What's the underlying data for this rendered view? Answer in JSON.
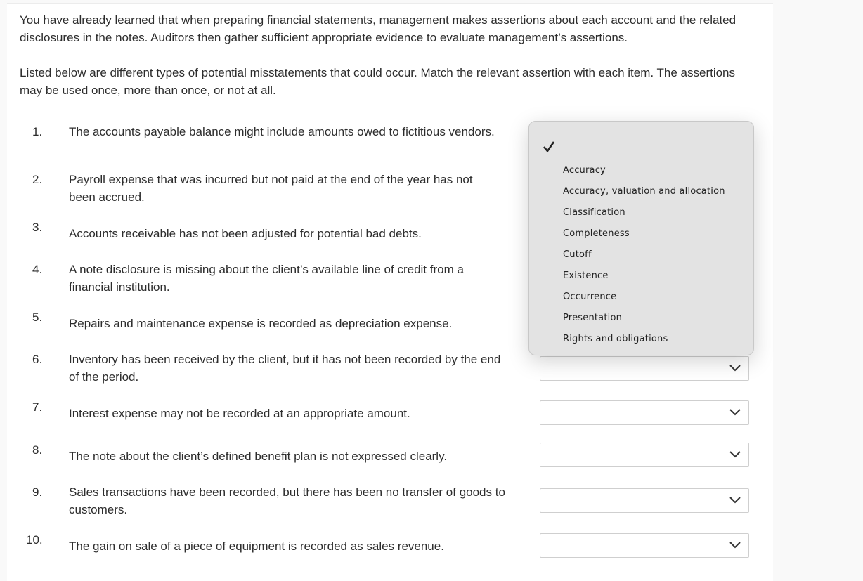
{
  "intro": {
    "paragraph1": "You have already learned that when preparing financial statements, management makes assertions about each account and the related disclosures in the notes. Auditors then gather sufficient appropriate evidence to evaluate management’s assertions.",
    "paragraph2": "Listed below are different types of potential misstatements that could occur. Match the relevant assertion with each item. The assertions may be used once, more than once, or not at all."
  },
  "items": [
    {
      "num": "1.",
      "text": "The accounts payable balance might include amounts owed to fictitious vendors."
    },
    {
      "num": "2.",
      "text": "Payroll expense that was incurred but not paid at the end of the year has not been accrued."
    },
    {
      "num": "3.",
      "text": "Accounts receivable has not been adjusted for potential bad debts."
    },
    {
      "num": "4.",
      "text": "A note disclosure is missing about the client’s available line of credit from a financial institution."
    },
    {
      "num": "5.",
      "text": "Repairs and maintenance expense is recorded as depreciation expense."
    },
    {
      "num": "6.",
      "text": "Inventory has been received by the client, but it has not been recorded by the end of the period."
    },
    {
      "num": "7.",
      "text": "Interest expense may not be recorded at an appropriate amount."
    },
    {
      "num": "8.",
      "text": "The note about the client’s defined benefit plan is not expressed clearly."
    },
    {
      "num": "9.",
      "text": "Sales transactions have been recorded, but there has been no transfer of goods to customers."
    },
    {
      "num": "10.",
      "text": "The gain on sale of a piece of equipment is recorded as sales revenue."
    }
  ],
  "selects": [
    {
      "value": ""
    },
    {
      "value": ""
    },
    {
      "value": ""
    },
    {
      "value": ""
    },
    {
      "value": ""
    }
  ],
  "dropdown": {
    "selected": "",
    "options": [
      "Accuracy",
      "Accuracy, valuation and allocation",
      "Classification",
      "Completeness",
      "Cutoff",
      "Existence",
      "Occurrence",
      "Presentation",
      "Rights and obligations"
    ]
  }
}
